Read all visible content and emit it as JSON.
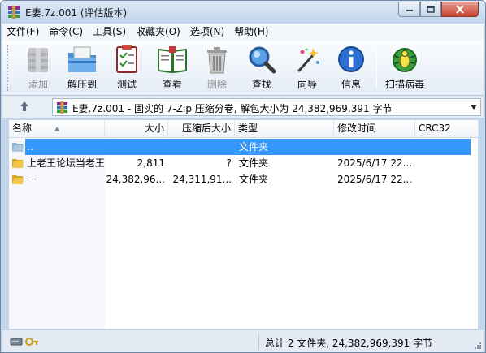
{
  "window": {
    "title": "E妻.7z.001 (评估版本)"
  },
  "menubar": {
    "items": [
      {
        "label": "文件(F)"
      },
      {
        "label": "命令(C)"
      },
      {
        "label": "工具(S)"
      },
      {
        "label": "收藏夹(O)"
      },
      {
        "label": "选项(N)"
      },
      {
        "label": "帮助(H)"
      }
    ]
  },
  "toolbar": {
    "add": "添加",
    "extract": "解压到",
    "test": "测试",
    "view": "查看",
    "delete": "删除",
    "find": "查找",
    "wizard": "向导",
    "info": "信息",
    "scan": "扫描病毒"
  },
  "address": {
    "text": "E妻.7z.001 - 固实的 7-Zip 压缩分卷, 解包大小为 24,382,969,391 字节"
  },
  "columns": {
    "name": "名称",
    "size": "大小",
    "packed": "压缩后大小",
    "type": "类型",
    "modified": "修改时间",
    "crc": "CRC32"
  },
  "rows": [
    {
      "name": "..",
      "size": "",
      "packed": "",
      "type": "文件夹",
      "modified": "",
      "crc": "",
      "selected": true
    },
    {
      "name": "上老王论坛当老王",
      "size": "2,811",
      "packed": "?",
      "type": "文件夹",
      "modified": "2025/6/17 22...",
      "crc": "",
      "selected": false
    },
    {
      "name": "一",
      "size": "24,382,96...",
      "packed": "24,311,91...",
      "type": "文件夹",
      "modified": "2025/6/17 22...",
      "crc": "",
      "selected": false
    }
  ],
  "status": {
    "summary": "总计 2 文件夹, 24,382,969,391 字节"
  },
  "colors": {
    "selection": "#3399ff",
    "title_bg": "#c4d6ec"
  }
}
